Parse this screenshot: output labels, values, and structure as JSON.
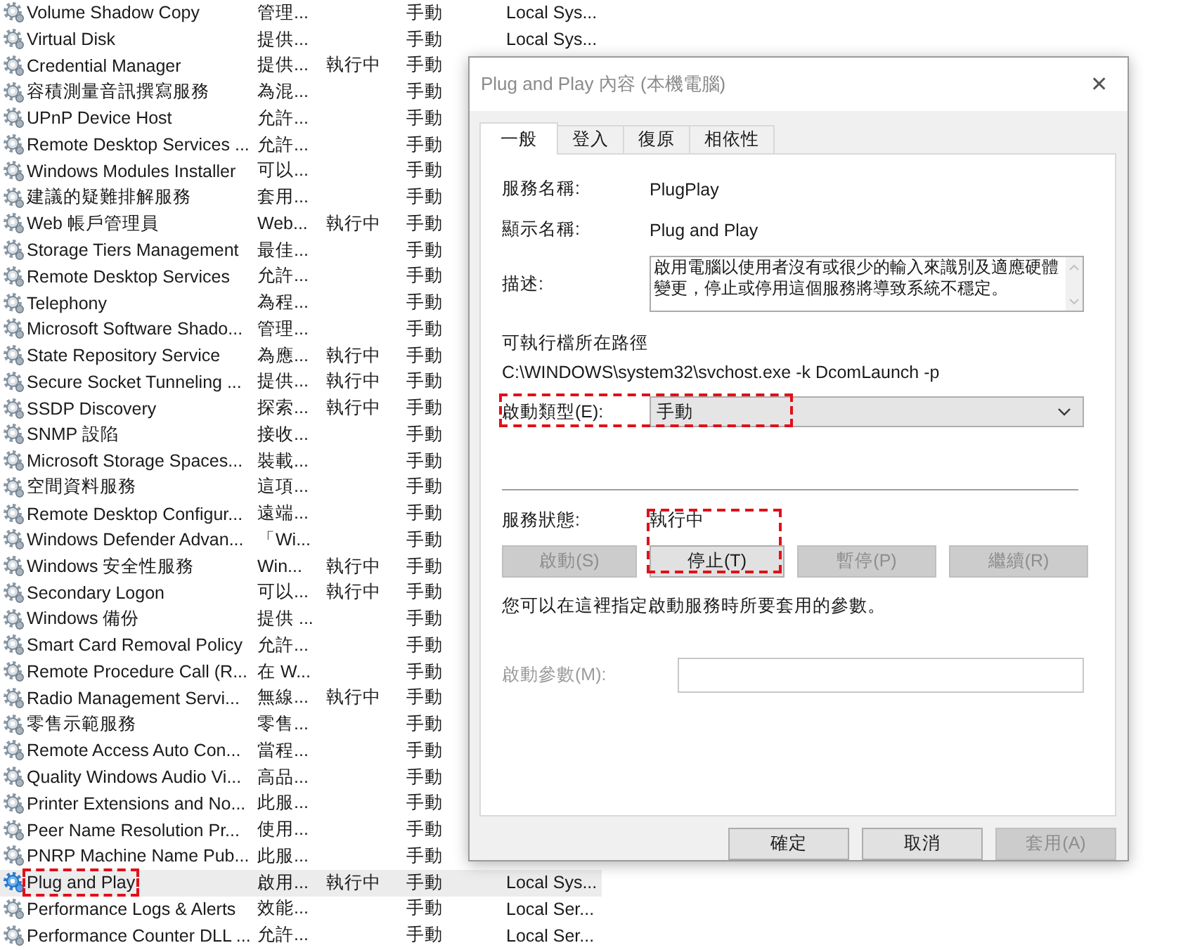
{
  "services": [
    {
      "name": "Volume Shadow Copy",
      "description": "管理...",
      "startup": "手動",
      "logon": "Local Sys...",
      "selected": false,
      "highlighted": false
    },
    {
      "name": "Virtual Disk",
      "description": "提供...",
      "startup": "手動",
      "logon": "Local Sys...",
      "selected": false,
      "highlighted": false
    },
    {
      "name": "Credential Manager",
      "description": "提供...",
      "status": "執行中",
      "startup": "手動",
      "selected": false,
      "highlighted": false
    },
    {
      "name": "容積測量音訊撰寫服務",
      "description": "為混...",
      "startup": "手動",
      "selected": false,
      "highlighted": false
    },
    {
      "name": "UPnP Device Host",
      "description": "允許...",
      "startup": "手動",
      "selected": false,
      "highlighted": false
    },
    {
      "name": "Remote Desktop Services ...",
      "description": "允許...",
      "startup": "手動",
      "selected": false,
      "highlighted": false
    },
    {
      "name": "Windows Modules Installer",
      "description": "可以...",
      "startup": "手動",
      "selected": false,
      "highlighted": false
    },
    {
      "name": "建議的疑難排解服務",
      "description": "套用...",
      "startup": "手動",
      "selected": false,
      "highlighted": false
    },
    {
      "name": "Web 帳戶管理員",
      "description": "Web...",
      "status": "執行中",
      "startup": "手動",
      "selected": false,
      "highlighted": false
    },
    {
      "name": "Storage Tiers Management",
      "description": "最佳...",
      "startup": "手動",
      "selected": false,
      "highlighted": false
    },
    {
      "name": "Remote Desktop Services",
      "description": "允許...",
      "startup": "手動",
      "selected": false,
      "highlighted": false
    },
    {
      "name": "Telephony",
      "description": "為程...",
      "startup": "手動",
      "selected": false,
      "highlighted": false
    },
    {
      "name": "Microsoft Software Shado...",
      "description": "管理...",
      "startup": "手動",
      "selected": false,
      "highlighted": false
    },
    {
      "name": "State Repository Service",
      "description": "為應...",
      "status": "執行中",
      "startup": "手動",
      "selected": false,
      "highlighted": false
    },
    {
      "name": "Secure Socket Tunneling ...",
      "description": "提供...",
      "status": "執行中",
      "startup": "手動",
      "selected": false,
      "highlighted": false
    },
    {
      "name": "SSDP Discovery",
      "description": "探索...",
      "status": "執行中",
      "startup": "手動",
      "selected": false,
      "highlighted": false
    },
    {
      "name": "SNMP 設陷",
      "description": "接收...",
      "startup": "手動",
      "selected": false,
      "highlighted": false
    },
    {
      "name": "Microsoft Storage Spaces...",
      "description": "裝載...",
      "startup": "手動",
      "selected": false,
      "highlighted": false
    },
    {
      "name": "空間資料服務",
      "description": "這項...",
      "startup": "手動",
      "selected": false,
      "highlighted": false
    },
    {
      "name": "Remote Desktop Configur...",
      "description": "遠端...",
      "startup": "手動",
      "selected": false,
      "highlighted": false
    },
    {
      "name": "Windows Defender Advan...",
      "description": "「Wi...",
      "startup": "手動",
      "selected": false,
      "highlighted": false
    },
    {
      "name": "Windows 安全性服務",
      "description": "Win...",
      "status": "執行中",
      "startup": "手動",
      "selected": false,
      "highlighted": false
    },
    {
      "name": "Secondary Logon",
      "description": "可以...",
      "status": "執行中",
      "startup": "手動",
      "selected": false,
      "highlighted": false
    },
    {
      "name": "Windows 備份",
      "description": "提供 ...",
      "startup": "手動",
      "selected": false,
      "highlighted": false
    },
    {
      "name": "Smart Card Removal Policy",
      "description": "允許...",
      "startup": "手動",
      "selected": false,
      "highlighted": false
    },
    {
      "name": "Remote Procedure Call (R...",
      "description": "在 W...",
      "startup": "手動",
      "selected": false,
      "highlighted": false
    },
    {
      "name": "Radio Management Servi...",
      "description": "無線...",
      "status": "執行中",
      "startup": "手動",
      "selected": false,
      "highlighted": false
    },
    {
      "name": "零售示範服務",
      "description": "零售...",
      "startup": "手動",
      "selected": false,
      "highlighted": false
    },
    {
      "name": "Remote Access Auto Con...",
      "description": "當程...",
      "startup": "手動",
      "selected": false,
      "highlighted": false
    },
    {
      "name": "Quality Windows Audio Vi...",
      "description": "高品...",
      "startup": "手動",
      "selected": false,
      "highlighted": false
    },
    {
      "name": "Printer Extensions and No...",
      "description": "此服...",
      "startup": "手動",
      "selected": false,
      "highlighted": false
    },
    {
      "name": "Peer Name Resolution Pr...",
      "description": "使用...",
      "startup": "手動",
      "selected": false,
      "highlighted": false
    },
    {
      "name": "PNRP Machine Name Pub...",
      "description": "此服...",
      "startup": "手動",
      "selected": false,
      "highlighted": false
    },
    {
      "name": "Plug and Play",
      "description": "啟用...",
      "status": "執行中",
      "startup": "手動",
      "logon": "Local Sys...",
      "selected": true,
      "highlighted": true
    },
    {
      "name": "Performance Logs & Alerts",
      "description": "效能...",
      "startup": "手動",
      "logon": "Local Ser...",
      "selected": false,
      "highlighted": false
    },
    {
      "name": "Performance Counter DLL ...",
      "description": "允許...",
      "startup": "手動",
      "logon": "Local Ser...",
      "selected": false,
      "highlighted": false
    }
  ],
  "dialog": {
    "title": "Plug and Play 內容 (本機電腦)",
    "close": "✕",
    "tabs": [
      {
        "label": "一般",
        "selected": true
      },
      {
        "label": "登入",
        "selected": false
      },
      {
        "label": "復原",
        "selected": false
      },
      {
        "label": "相依性",
        "selected": false
      }
    ],
    "service_name": {
      "label": "服務名稱:",
      "value": "PlugPlay"
    },
    "display_name": {
      "label": "顯示名稱:",
      "value": "Plug and Play"
    },
    "description": {
      "label": "描述:",
      "value": "啟用電腦以使用者沒有或很少的輸入來識別及適應硬體變更，停止或停用這個服務將導致系統不穩定。"
    },
    "path": {
      "label": "可執行檔所在路徑",
      "value": "C:\\WINDOWS\\system32\\svchost.exe -k DcomLaunch -p"
    },
    "startup_type": {
      "label": "啟動類型(E):",
      "value": "手動",
      "highlighted": true
    },
    "service_status": {
      "label": "服務狀態:",
      "value": "執行中"
    },
    "control_buttons": [
      {
        "label": "啟動(S)",
        "disabled": true,
        "highlighted": false
      },
      {
        "label": "停止(T)",
        "disabled": false,
        "highlighted": true
      },
      {
        "label": "暫停(P)",
        "disabled": true,
        "highlighted": false
      },
      {
        "label": "繼續(R)",
        "disabled": true,
        "highlighted": false
      }
    ],
    "hint": "您可以在這裡指定啟動服務時所要套用的參數。",
    "start_parameters": {
      "label": "啟動參數(M):",
      "disabled": true
    },
    "buttons": [
      {
        "label": "確定",
        "disabled": false
      },
      {
        "label": "取消",
        "disabled": false
      },
      {
        "label": "套用(A)",
        "disabled": true
      }
    ]
  }
}
